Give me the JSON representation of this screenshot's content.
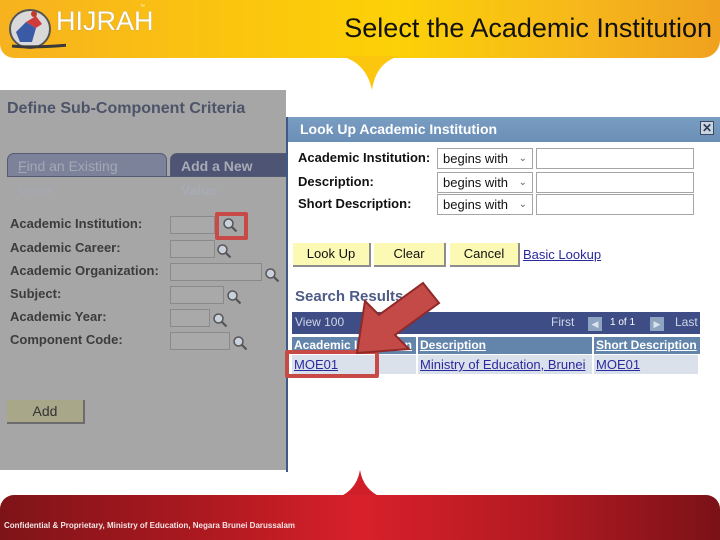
{
  "slide": {
    "title": "Select the Academic Institution",
    "logo_text": "HIJRAH",
    "logo_tm": "™",
    "footer": "Confidential & Proprietary, Ministry of Education, Negara Brunei Darussalam",
    "colors": {
      "banner": "#fcc60d",
      "footer": "#d8202a",
      "highlight": "#c84a47"
    }
  },
  "page": {
    "title": "Define Sub-Component Criteria",
    "tabs": [
      {
        "label": "Find an Existing Value",
        "accesskey": "F",
        "rest": "ind an Existing Value",
        "active": false
      },
      {
        "label": "Add a New Value",
        "active": true
      }
    ],
    "fields": [
      {
        "label": "Academic Institution:",
        "value": ""
      },
      {
        "label": "Academic Career:",
        "value": ""
      },
      {
        "label": "Academic Organization:",
        "value": ""
      },
      {
        "label": "Subject:",
        "value": ""
      },
      {
        "label": "Academic Year:",
        "value": ""
      },
      {
        "label": "Component Code:",
        "value": ""
      }
    ],
    "add_button": "Add"
  },
  "modal": {
    "title": "Look Up Academic Institution",
    "close_icon": "close-icon",
    "criteria": [
      {
        "label": "Academic Institution:",
        "operator": "begins with",
        "value": ""
      },
      {
        "label": "Description:",
        "operator": "begins with",
        "value": ""
      },
      {
        "label": "Short Description:",
        "operator": "begins with",
        "value": ""
      }
    ],
    "buttons": {
      "lookup": "Look Up",
      "clear": "Clear",
      "cancel": "Cancel"
    },
    "basic_lookup": "Basic Lookup",
    "results_title": "Search Results",
    "grid": {
      "view_all": "View 100",
      "first": "First",
      "count": "1 of 1",
      "last": "Last",
      "columns": [
        "Academic Institution",
        "Description",
        "Short Description"
      ],
      "rows": [
        [
          "MOE01",
          "Ministry of Education, Brunei",
          "MOE01"
        ]
      ]
    }
  }
}
